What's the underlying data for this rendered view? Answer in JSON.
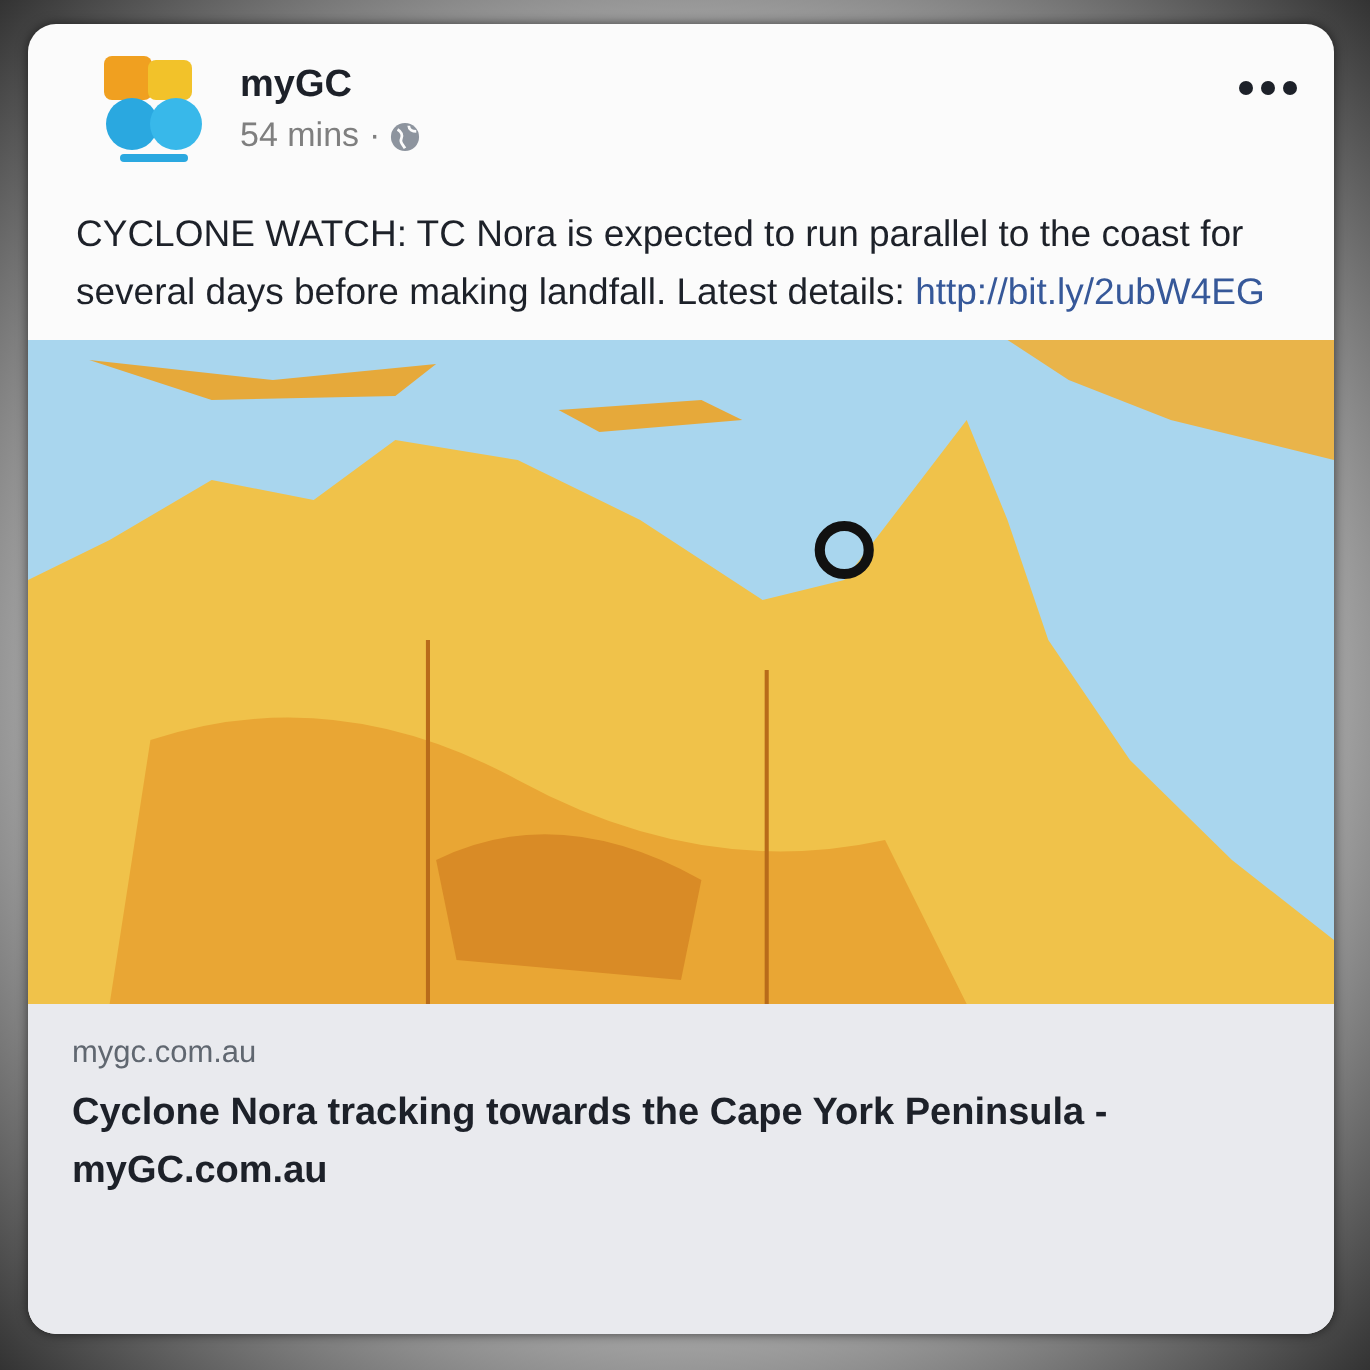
{
  "post": {
    "page_name": "myGC",
    "time": "54 mins",
    "separator": "·",
    "text": "CYCLONE WATCH: TC Nora is expected to run parallel to the coast for several days before making landfall. Latest details: ",
    "link": "http://bit.ly/2ubW4EG"
  },
  "preview": {
    "domain": "mygc.com.au",
    "title": "Cyclone Nora tracking towards the Cape York Peninsula - myGC.com.au"
  }
}
